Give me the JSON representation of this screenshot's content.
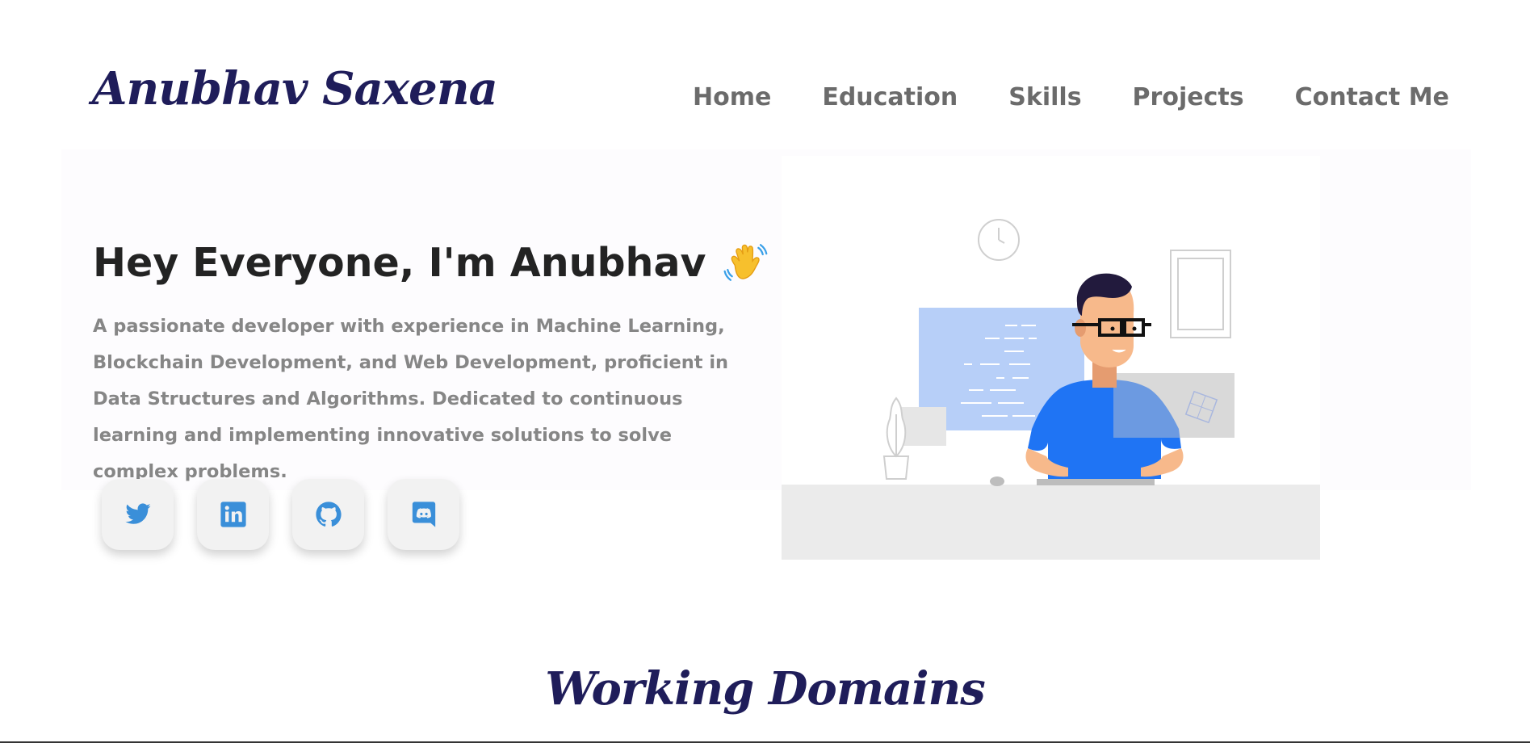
{
  "header": {
    "logo": "Anubhav Saxena",
    "nav": [
      "Home",
      "Education",
      "Skills",
      "Projects",
      "Contact Me"
    ]
  },
  "hero": {
    "greeting": "Hey Everyone, I'm Anubhav",
    "wave_icon": "waving-hand-icon",
    "description": "A passionate developer with experience in Machine Learning, Blockchain Development, and Web Development, proficient in Data Structures and Algorithms. Dedicated to continuous learning and implementing innovative solutions to solve complex problems.",
    "socials": [
      {
        "icon": "twitter-icon"
      },
      {
        "icon": "linkedin-icon"
      },
      {
        "icon": "github-icon"
      },
      {
        "icon": "discord-icon"
      }
    ]
  },
  "sections": {
    "working_domains_title": "Working Domains"
  },
  "colors": {
    "brand": "#1f1d5a",
    "icon": "#3a8fd9",
    "accent_blue": "#1e72f0"
  }
}
